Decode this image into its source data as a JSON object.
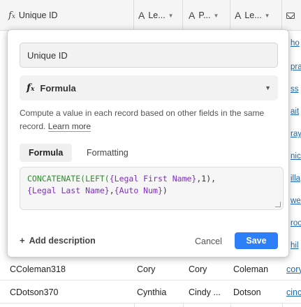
{
  "columns": [
    {
      "icon": "formula-icon",
      "label": "Unique ID"
    },
    {
      "icon": "text-icon",
      "label": "Le..."
    },
    {
      "icon": "text-icon",
      "label": "P..."
    },
    {
      "icon": "text-icon",
      "label": "Le..."
    },
    {
      "icon": "email-icon",
      "label": ""
    }
  ],
  "rows": [
    {
      "id": "CColeman318",
      "first": "Cory",
      "preferred": "Cory",
      "last": "Coleman",
      "email": "cory"
    },
    {
      "id": "CDotson370",
      "first": "Cynthia",
      "preferred": "Cindy ...",
      "last": "Dotson",
      "email": "cinc"
    }
  ],
  "side_links": [
    "ho",
    "pra",
    "ss",
    "ait",
    "ray",
    "nick",
    "illa",
    "we",
    "roo",
    "hil"
  ],
  "modal": {
    "field_name": "Unique ID",
    "field_type": "Formula",
    "description_text": "Compute a value in each record based on other fields in the same record.",
    "learn_more": "Learn more",
    "tabs": [
      "Formula",
      "Formatting"
    ],
    "formula": {
      "fn1": "CONCATENATE(",
      "fn2": "LEFT(",
      "field1": "{Legal First Name}",
      "arg1": ",1),",
      "field2": "{Legal Last Name}",
      "comma": ",",
      "field3": "{Auto Num}",
      "close": ")"
    },
    "add_description": "Add description",
    "cancel": "Cancel",
    "save": "Save"
  },
  "colors": {
    "accent": "#2d7ff9",
    "function": "#2e8b2e",
    "field_ref": "#7b2fbf",
    "link": "#1a6ab3"
  }
}
